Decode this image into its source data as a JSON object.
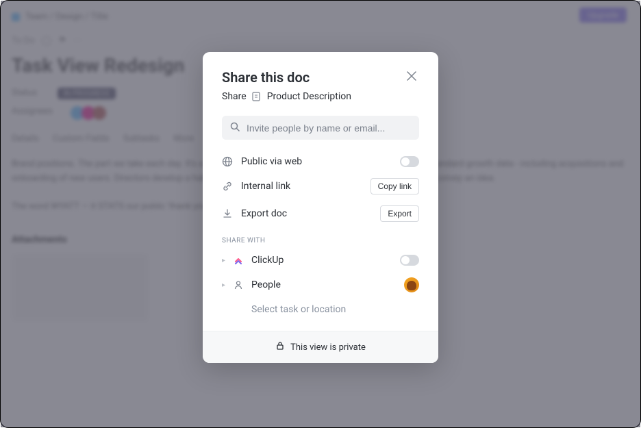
{
  "background": {
    "breadcrumb": "Team  /  Design  /  Title",
    "upgrade": "Upgrade",
    "to_do": "To Do",
    "title": "Task View Redesign",
    "status_label": "Status",
    "status_value": "IN PROGRESS",
    "assignees_label": "Assignees",
    "tabs": [
      "Details",
      "Custom Fields",
      "Subtasks",
      "More"
    ],
    "body": "Brand positions. The part we take each day. It's a kind of tattoo that we can never remove. This covers the standard growth data - including acquisitions and onboarding of new users. Directors develop a habit for Lucidifiable. Connections. Positions are recipes that convey an idea.",
    "body2": "The word WYATT — it STATS our public 'thank you' for today.",
    "attachments": "Attachments"
  },
  "modal": {
    "title": "Share this doc",
    "share_label": "Share",
    "doc_name": "Product Description",
    "search_placeholder": "Invite people by name or email...",
    "options": {
      "public_web": "Public via web",
      "internal_link": "Internal link",
      "copy_link": "Copy link",
      "export_doc": "Export doc",
      "export": "Export"
    },
    "share_with_header": "SHARE WITH",
    "share_items": {
      "clickup": "ClickUp",
      "people": "People",
      "select_task": "Select task or location"
    },
    "footer": "This view is private"
  }
}
